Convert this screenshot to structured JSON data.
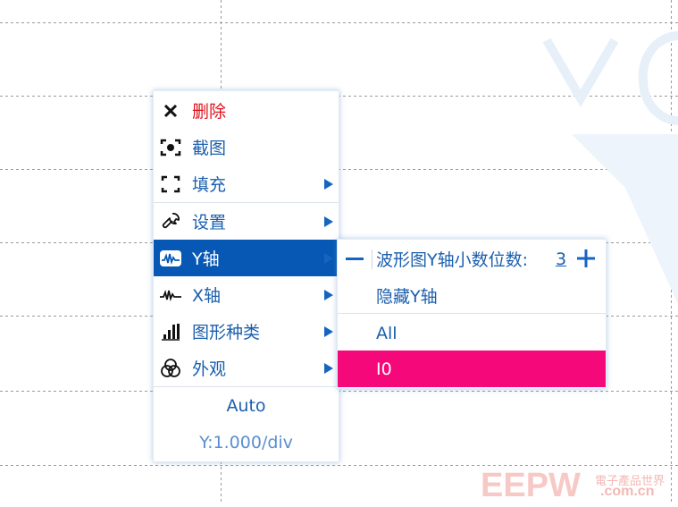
{
  "context_menu": {
    "items": [
      {
        "label": "删除",
        "icon": "close-icon"
      },
      {
        "label": "截图",
        "icon": "screenshot-icon"
      },
      {
        "label": "填充",
        "icon": "fill-icon"
      },
      {
        "label": "设置",
        "icon": "wrench-icon"
      },
      {
        "label": "Y轴",
        "icon": "waveform-box-icon"
      },
      {
        "label": "X轴",
        "icon": "waveform-icon"
      },
      {
        "label": "图形种类",
        "icon": "bar-chart-icon"
      },
      {
        "label": "外观",
        "icon": "appearance-icon"
      }
    ],
    "auto_label": "Auto",
    "scale_label": "Y:1.000/div"
  },
  "y_axis_submenu": {
    "decimals_label": "波形图Y轴小数位数:",
    "decimals_value": "3",
    "hide_label": "隐藏Y轴",
    "all_label": "All",
    "channel_label": "I0"
  },
  "colors": {
    "accent": "#0758b4",
    "highlight": "#f5087a",
    "danger": "#e0101a",
    "text": "#1b5fae"
  },
  "watermark": {
    "brand": "EEPW",
    "domain": ".com.cn",
    "slogan": "電子產品世界"
  }
}
